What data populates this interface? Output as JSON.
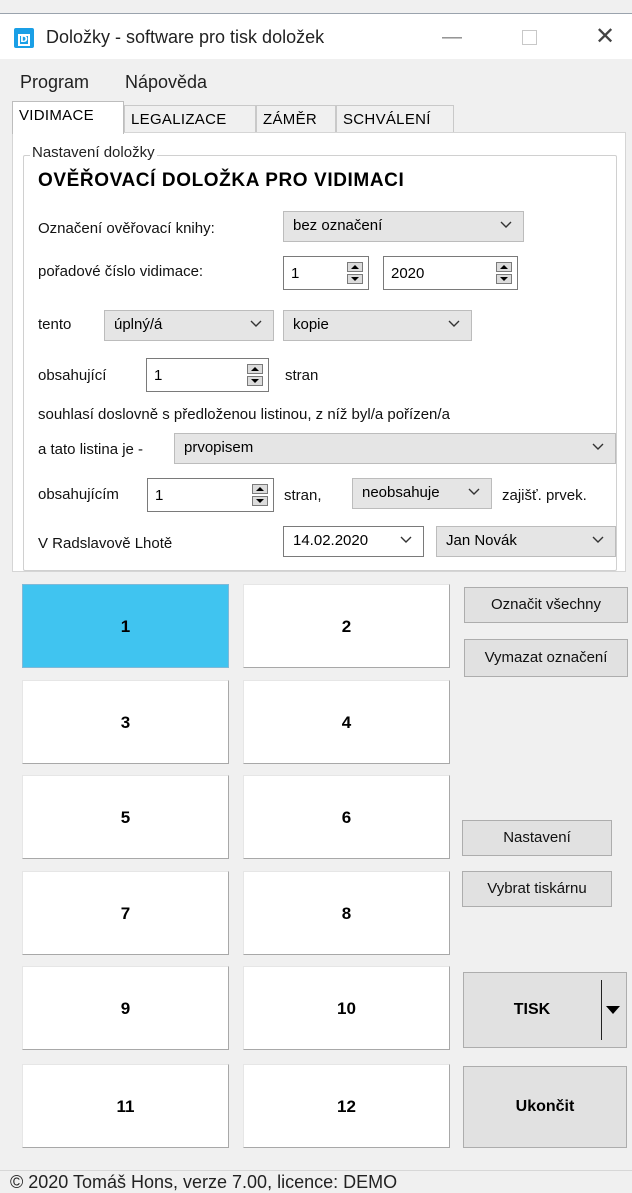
{
  "window": {
    "app_icon_letter": "D",
    "title": "Doložky - software pro tisk doložek",
    "minimize": "—",
    "close": "✕"
  },
  "menu": [
    "Program",
    "Nápověda"
  ],
  "tabs": [
    "VIDIMACE",
    "LEGALIZACE",
    "ZÁMĚR",
    "SCHVÁLENÍ"
  ],
  "form": {
    "group_label": "Nastavení doložky",
    "heading": "OVĚŘOVACÍ DOLOŽKA PRO VIDIMACI",
    "book_label": "Označení ověřovací knihy:",
    "book_value": "bez označení",
    "seq_label": "pořadové číslo vidimace:",
    "seq_number": "1",
    "seq_year": "2020",
    "tento_label": "tento",
    "tento_value": "úplný/á",
    "type_value": "kopie",
    "obsah_label": "obsahující",
    "obsah_value": "1",
    "stran_label": "stran",
    "statement": "souhlasí doslovně s předloženou listinou, z níž byl/a pořízen/a",
    "listina_label": "a tato listina je -",
    "listina_value": "prvopisem",
    "obsah2_label": "obsahujícím",
    "obsah2_value": "1",
    "stran2_label": "stran,",
    "prvky_value": "neobsahuje",
    "prvky_label": "zajišť. prvek.",
    "place_label": "V Radslavově Lhotě",
    "date_value": "14.02.2020",
    "person_value": "Jan Novák"
  },
  "grid": [
    "1",
    "2",
    "3",
    "4",
    "5",
    "6",
    "7",
    "8",
    "9",
    "10",
    "11",
    "12"
  ],
  "selected_grid": "1",
  "colors": {
    "selected": "#40c4f0",
    "app_icon": "#1a9fe6"
  },
  "actions": {
    "mark_all": "Označit všechny",
    "clear_marks": "Vymazat označení",
    "settings": "Nastavení",
    "printer": "Vybrat tiskárnu",
    "print": "TISK",
    "exit": "Ukončit"
  },
  "footer": "© 2020 Tomáš Hons, verze 7.00, licence: DEMO"
}
